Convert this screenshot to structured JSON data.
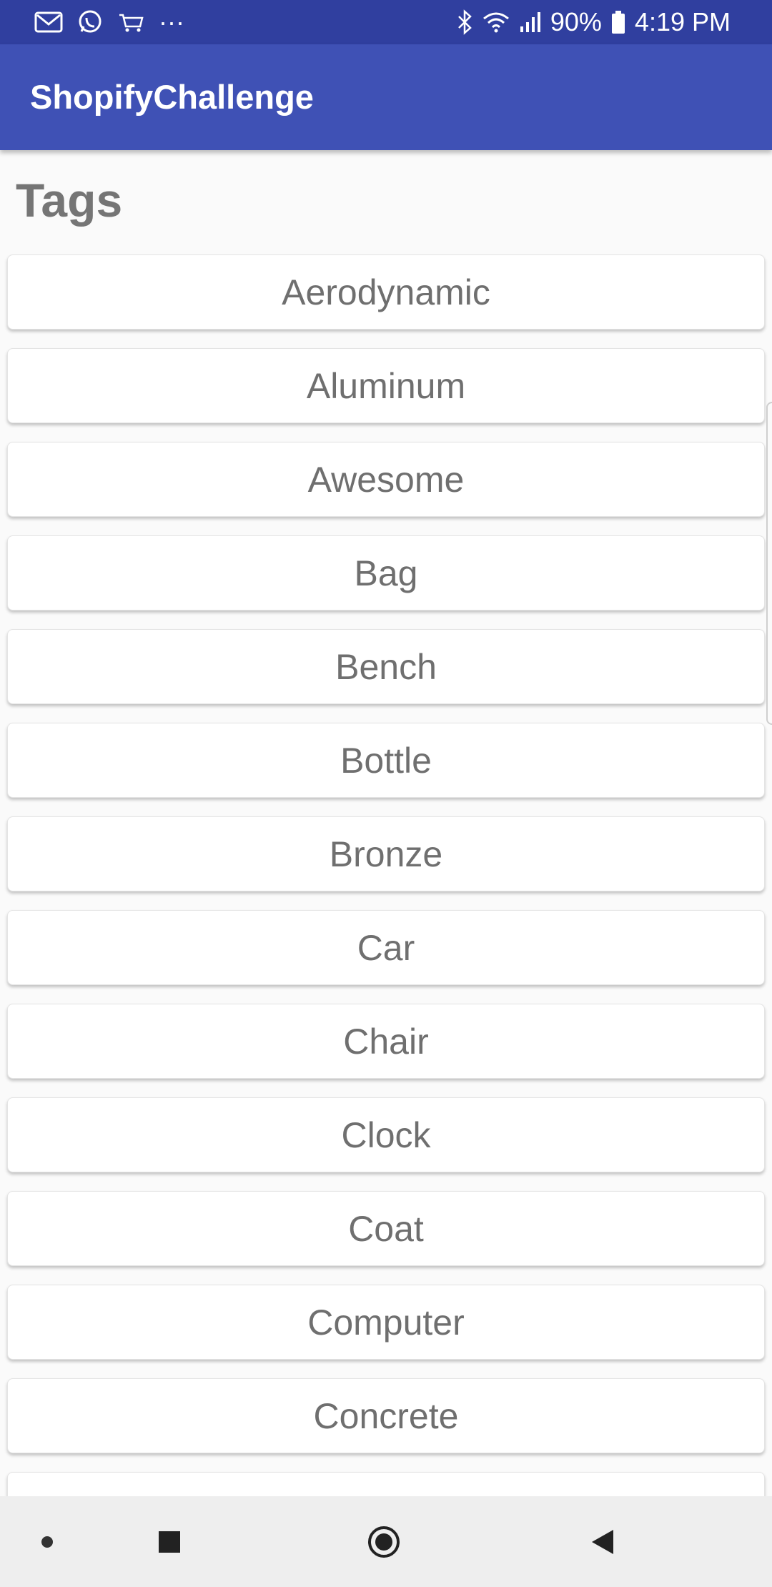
{
  "status_bar": {
    "battery_percent": "90%",
    "time": "4:19 PM",
    "more_indicator": "···",
    "left_icons": [
      "gmail-icon",
      "whatsapp-icon",
      "amazon-cart-icon",
      "more-notifications-icon"
    ],
    "right_icons": [
      "bluetooth-icon",
      "wifi-icon",
      "signal-icon",
      "battery-icon"
    ]
  },
  "app_bar": {
    "title": "ShopifyChallenge"
  },
  "main": {
    "section_title": "Tags",
    "tags": [
      "Aerodynamic",
      "Aluminum",
      "Awesome",
      "Bag",
      "Bench",
      "Bottle",
      "Bronze",
      "Car",
      "Chair",
      "Clock",
      "Coat",
      "Computer",
      "Concrete"
    ]
  },
  "nav_bar": {
    "buttons": [
      "dot-icon",
      "recents-icon",
      "home-icon",
      "back-icon"
    ]
  },
  "colors": {
    "status_bar": "#303f9f",
    "app_bar": "#3f51b5",
    "background": "#fafafa",
    "tag_text": "#6f6f6f",
    "nav_bar": "#eeeeee"
  }
}
